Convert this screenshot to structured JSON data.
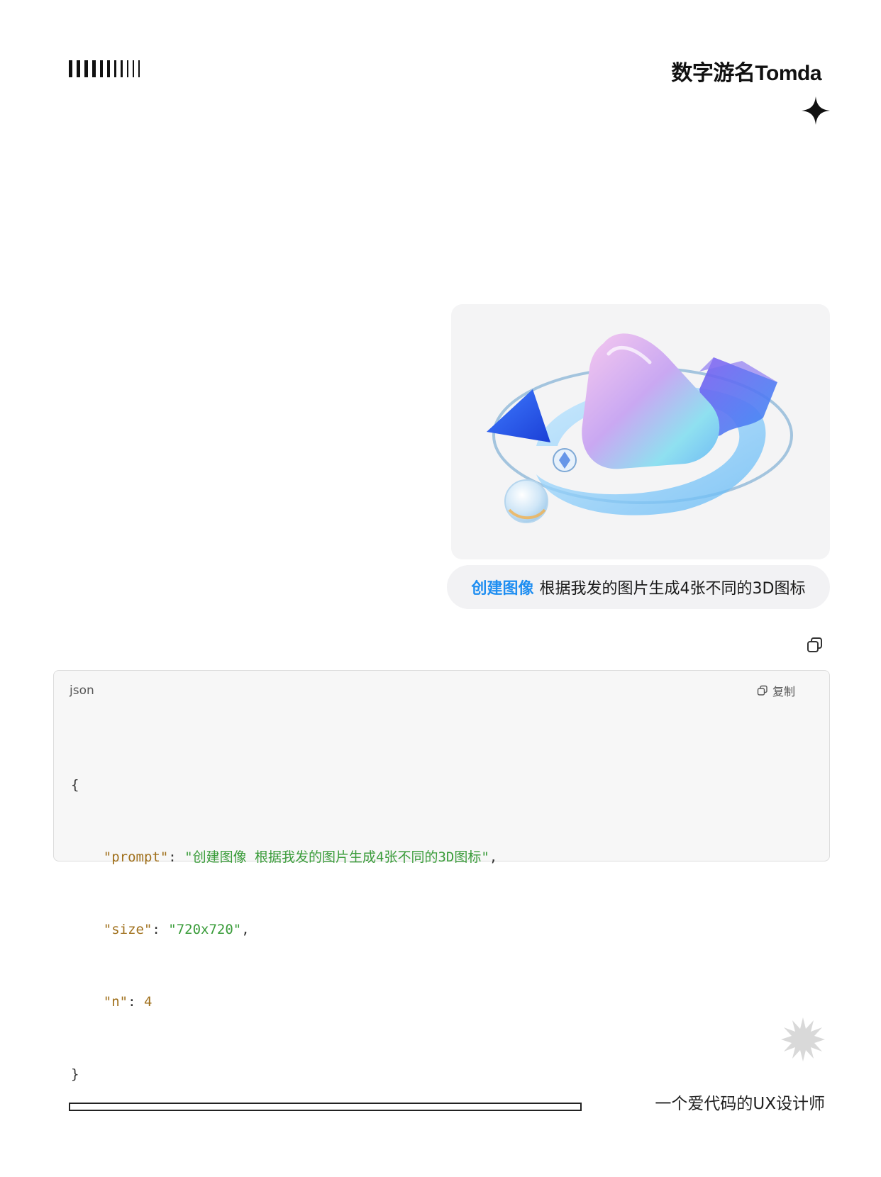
{
  "header": {
    "brand": "数字游名Tomda"
  },
  "message": {
    "image_icon": "3d-abstract-shapes-image",
    "prompt_command": "创建图像",
    "prompt_text": "根据我发的图片生成4张不同的3D图标"
  },
  "code_block": {
    "language": "json",
    "copy_label": "复制",
    "open_brace": "{",
    "close_brace": "}",
    "lines": [
      {
        "key": "\"prompt\"",
        "sep": ": ",
        "value": "\"创建图像 根据我发的图片生成4张不同的3D图标\"",
        "tail": ","
      },
      {
        "key": "\"size\"",
        "sep": ": ",
        "value": "\"720x720\"",
        "tail": ","
      },
      {
        "key": "\"n\"",
        "sep": ": ",
        "value": "4",
        "tail": ""
      }
    ]
  },
  "footer": {
    "tagline": "一个爱代码的UX设计师"
  },
  "colors": {
    "accent": "#1f8ef1",
    "json_key": "#a0701c",
    "json_string": "#3a9c3a"
  }
}
